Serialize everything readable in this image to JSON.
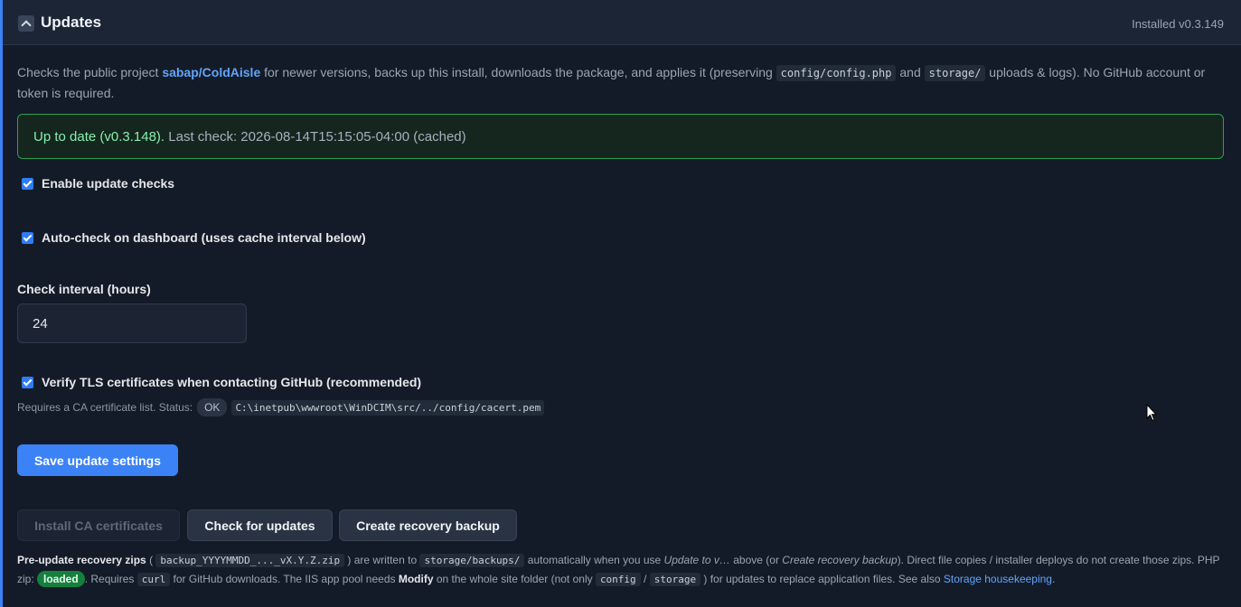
{
  "header": {
    "title": "Updates",
    "installed": "Installed v0.3.149"
  },
  "intro": {
    "p1": "Checks the public project ",
    "repo": "sabap/ColdAisle",
    "p2": " for newer versions, backs up this install, downloads the package, and applies it (preserving ",
    "code1": "config/config.php",
    "p3": " and ",
    "code2": "storage/",
    "p4": " uploads & logs). No GitHub account or token is required."
  },
  "status": {
    "ok_text": "Up to date (v0.3.148).",
    "rest_text": " Last check: 2026-08-14T15:15:05-04:00 (cached)"
  },
  "settings": {
    "enable_checks_label": "Enable update checks",
    "enable_checks": true,
    "auto_check_label": "Auto-check on dashboard (uses cache interval below)",
    "auto_check": true,
    "interval_label": "Check interval (hours)",
    "interval_value": "24",
    "verify_tls_label": "Verify TLS certificates when contacting GitHub (recommended)",
    "verify_tls": true,
    "tls_note_prefix": "Requires a CA certificate list. Status:",
    "tls_status": "OK",
    "tls_path": "C:\\inetpub\\wwwroot\\WinDCIM\\src/../config/cacert.pem"
  },
  "buttons": {
    "save": "Save update settings",
    "install_ca": "Install CA certificates",
    "check": "Check for updates",
    "recovery": "Create recovery backup"
  },
  "footer": {
    "b1": "Pre-update recovery zips",
    "t1": " ( ",
    "code_zip": "backup_YYYYMMDD_..._vX.Y.Z.zip",
    "t2": " ) are written to ",
    "code_backups": "storage/backups/",
    "t3": " automatically when you use ",
    "em1": "Update to v…",
    "t4": " above (or ",
    "em2": "Create recovery backup",
    "t5": "). Direct file copies / installer deploys do not create those zips. PHP zip: ",
    "zip_status": "loaded",
    "t6": ". Requires ",
    "code_curl": "curl",
    "t7": " for GitHub downloads. The IIS app pool needs ",
    "b2": "Modify",
    "t8": " on the whole site folder (not only ",
    "code_config": "config",
    "t9": " / ",
    "code_storage": "storage",
    "t10": " ) for updates to replace application files. See also ",
    "link": "Storage housekeeping",
    "t11": "."
  },
  "colors": {
    "accent": "#3b82f6",
    "success": "#2f9e55",
    "link": "#60a5fa"
  },
  "icons": {
    "collapse": "chevron-up-icon",
    "cursor": "mouse-pointer-icon"
  }
}
